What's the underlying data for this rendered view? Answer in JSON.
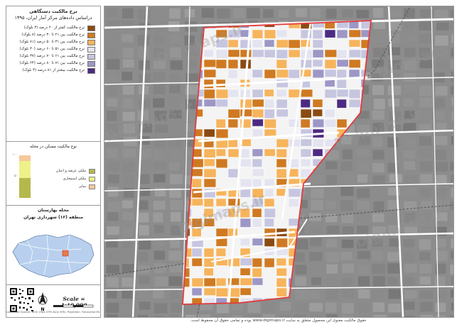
{
  "legend": {
    "title": "نرخ مالکیت دستگاهی",
    "subtitle": "دراساس داده‌های مرکز آمار ایران، ۱۳۹۵",
    "items": [
      {
        "label": "نرخ مالکیت کمتر از ۲۰ درصد (۳ بلوک)",
        "color": "#8b4a12"
      },
      {
        "label": "نرخ مالکیت بین ۲۱ تا ۳۰ درصد (۸ بلوک)",
        "color": "#cf7a22"
      },
      {
        "label": "نرخ مالکیت بین ۳۱ تا ۵۰ درصد (۸۱ بلوک)",
        "color": "#f6b45c"
      },
      {
        "label": "نرخ مالکیت بین ۵۱ تا ۶۰ درصد (۳۰ بلوک)",
        "color": "#e4e4f0"
      },
      {
        "label": "نرخ مالکیت بین ۶۱ تا ۷۰ درصد (۳۷ بلوک)",
        "color": "#c6c6e0"
      },
      {
        "label": "نرخ مالکیت بین ۷۱ تا ۸۰ درصد (۲۴ بلوک)",
        "color": "#9d97c6"
      },
      {
        "label": "نرخ مالکیت بیشتر از ۸۱ درصد (۳ بلوک)",
        "color": "#4d2a82"
      }
    ]
  },
  "chart": {
    "title": "نوع مالکیت مسکن در محله",
    "axis_top": "۱۰۰",
    "axis_mid": "۵۰",
    "axis_bottom": "۰",
    "segments": [
      {
        "label": "ملکی عرصه و اعیان",
        "share": 0.46,
        "color": "#b5b84a"
      },
      {
        "label": "ملکی استیجاری",
        "share": 0.4,
        "color": "#eef08a"
      },
      {
        "label": "سایر",
        "share": 0.14,
        "color": "#f6c79a"
      }
    ]
  },
  "location": {
    "line1": "محله بهارستان",
    "line2": "منطقه (۱۲) شهرداری تهران"
  },
  "scale": {
    "text": "Scale = 1:10,000"
  },
  "north": {
    "letter": "N"
  },
  "watermark": {
    "text": "Digimaps.ir"
  },
  "footer": {
    "text": "حقوق مالکیت معنوی این محصول متعلق به سایت www.digimaps.ir بوده و تمامی حقوق آن محفوظ است.",
    "small": "Coordinate System: WGS 1984 UTM Zone 39N | Projection: Transverse Mercator"
  },
  "colors": {
    "boundary": "#e23b3b",
    "road": "#ffffff",
    "basemap": "#8a8a8a"
  }
}
